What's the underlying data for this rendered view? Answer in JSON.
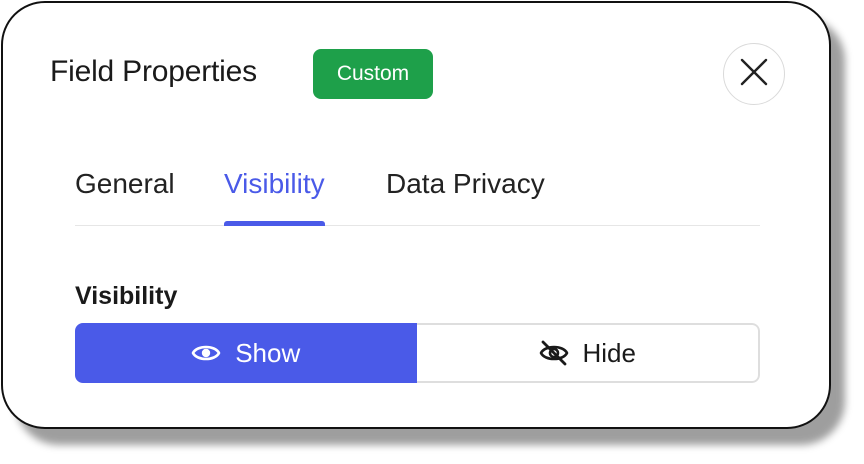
{
  "header": {
    "title": "Field Properties",
    "badge": "Custom",
    "close_icon": "close-icon"
  },
  "tabs": [
    {
      "label": "General",
      "active": false
    },
    {
      "label": "Visibility",
      "active": true
    },
    {
      "label": "Data Privacy",
      "active": false
    }
  ],
  "visibility": {
    "label": "Visibility",
    "options": [
      {
        "label": "Show",
        "icon": "eye-icon",
        "selected": true
      },
      {
        "label": "Hide",
        "icon": "eye-off-icon",
        "selected": false
      }
    ]
  },
  "colors": {
    "accent": "#4a5ae8",
    "badge": "#1ea04a"
  }
}
